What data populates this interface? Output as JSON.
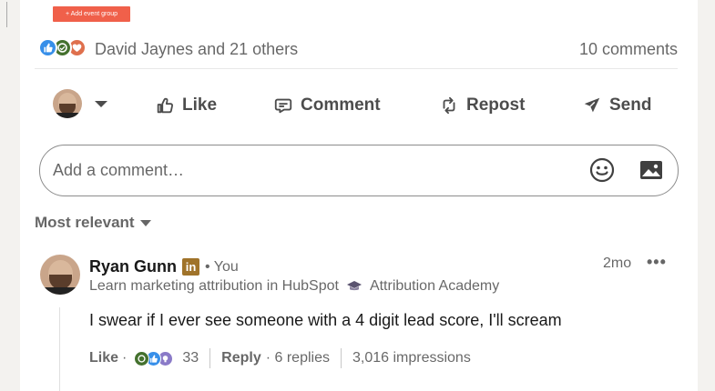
{
  "top": {
    "add_event_group_label": "+ Add event group"
  },
  "social": {
    "reactors_text": "David Jaynes and 21 others",
    "comments_text": "10 comments",
    "reaction_icons": [
      "like-icon",
      "celebrate-icon",
      "love-icon"
    ]
  },
  "actions": {
    "like": "Like",
    "comment": "Comment",
    "repost": "Repost",
    "send": "Send"
  },
  "composer": {
    "placeholder": "Add a comment…"
  },
  "sort": {
    "label": "Most relevant"
  },
  "comment": {
    "author": "Ryan Gunn",
    "badge": "in",
    "you_label": "• You",
    "headline_part1": "Learn marketing attribution in HubSpot",
    "headline_part2": "Attribution Academy",
    "time": "2mo",
    "more": "•••",
    "text": "I swear if I ever see someone with a 4 digit lead score, I'll scream",
    "like_label": "Like",
    "dot1": "·",
    "reaction_count": "33",
    "reply_label": "Reply",
    "replies": "· 6 replies",
    "impressions": "3,016 impressions"
  },
  "colors": {
    "accent_red": "#f0604a",
    "like_blue": "#378fe9",
    "celebrate_green": "#44712e",
    "love_orange": "#df704d",
    "linkedin_badge": "#a0732a"
  }
}
